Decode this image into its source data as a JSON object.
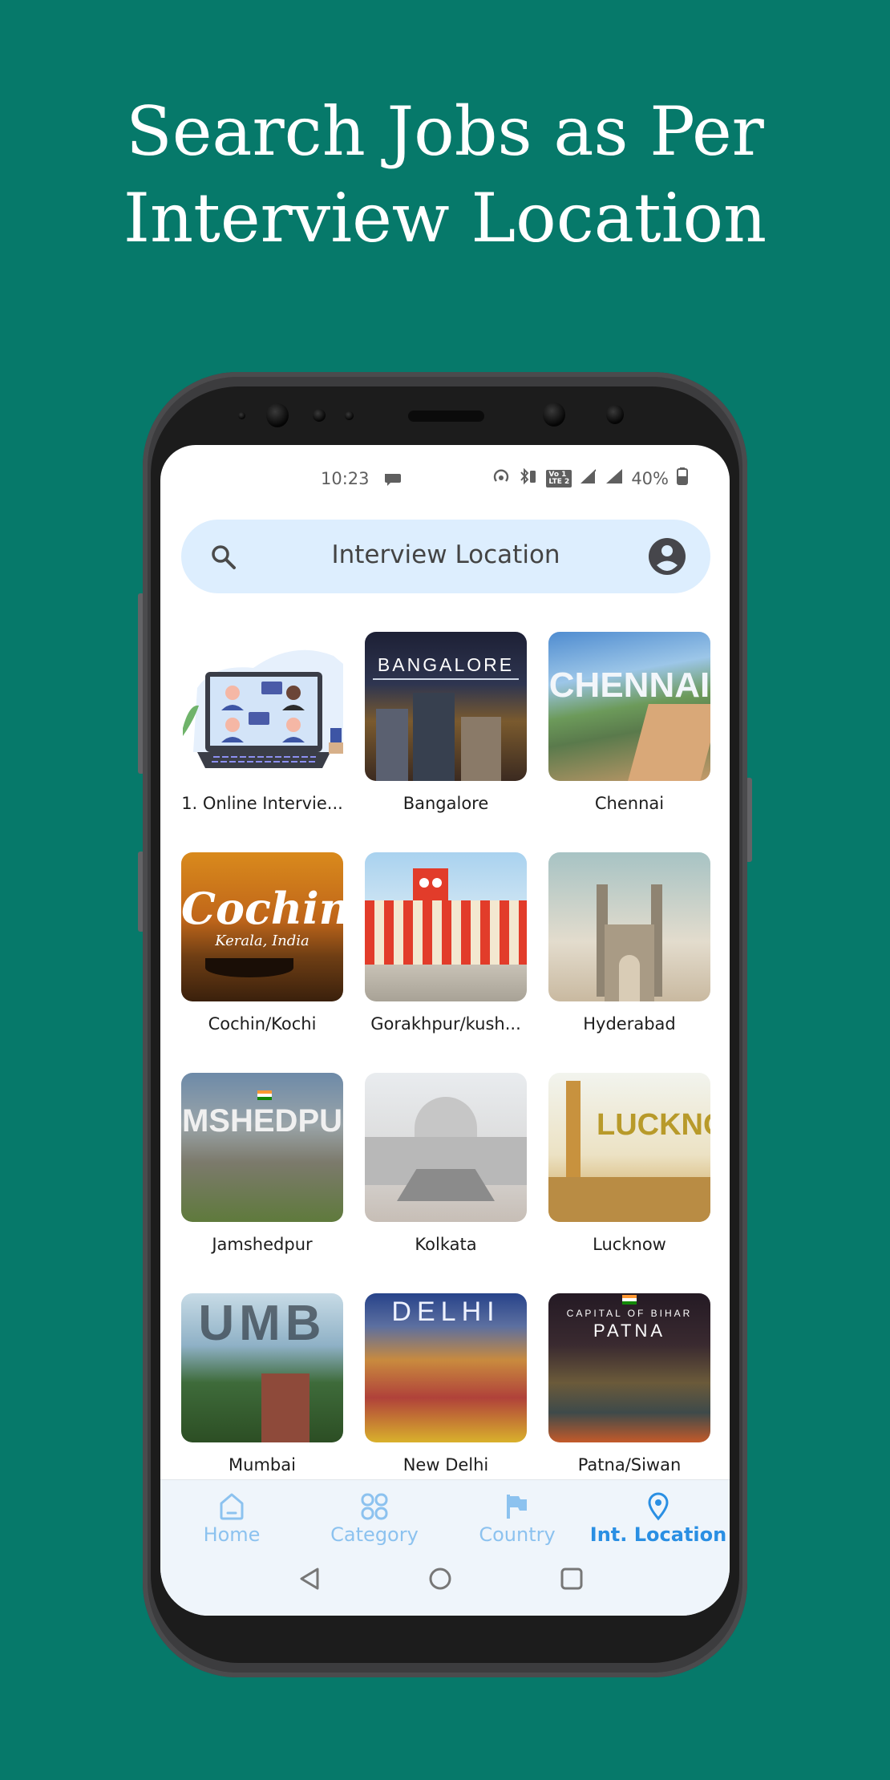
{
  "promo": {
    "title_line1": "Search Jobs as Per",
    "title_line2": "Interview Location",
    "background_color": "#06796a"
  },
  "status_bar": {
    "time": "10:23",
    "battery": "40%",
    "network_badge_top": "Vo 1",
    "network_badge_bottom": "LTE 2",
    "icons": [
      "message-icon",
      "hotspot-icon",
      "bluetooth-icon",
      "volte-icon",
      "signal-1-icon",
      "signal-2-icon",
      "battery-icon"
    ]
  },
  "search_bar": {
    "title": "Interview Location",
    "icon_left": "search-icon",
    "icon_right": "account-icon"
  },
  "locations": [
    {
      "label": "1. Online Intervie...",
      "image": "online-interview-illustration"
    },
    {
      "label": "Bangalore",
      "image": "bangalore-photo",
      "overlay": "BANGALORE"
    },
    {
      "label": "Chennai",
      "image": "chennai-photo",
      "overlay": "CHENNAI"
    },
    {
      "label": "Cochin/Kochi",
      "image": "cochin-photo",
      "overlay": "Cochin",
      "overlay_sub": "Kerala, India"
    },
    {
      "label": "Gorakhpur/kush...",
      "image": "gorakhpur-photo"
    },
    {
      "label": "Hyderabad",
      "image": "hyderabad-photo"
    },
    {
      "label": "Jamshedpur",
      "image": "jamshedpur-photo",
      "overlay": "MSHEDPU"
    },
    {
      "label": "Kolkata",
      "image": "kolkata-photo"
    },
    {
      "label": "Lucknow",
      "image": "lucknow-photo",
      "overlay": "LUCKNO"
    },
    {
      "label": "Mumbai",
      "image": "mumbai-photo",
      "overlay": "UMB"
    },
    {
      "label": "New Delhi",
      "image": "delhi-photo",
      "overlay": "DELHI"
    },
    {
      "label": "Patna/Siwan",
      "image": "patna-photo",
      "overlay": "PATNA",
      "overlay_sub": "CAPITAL OF BIHAR"
    }
  ],
  "bottom_nav": {
    "items": [
      {
        "label": "Home",
        "icon": "home-icon",
        "active": false
      },
      {
        "label": "Category",
        "icon": "category-icon",
        "active": false
      },
      {
        "label": "Country",
        "icon": "flag-icon",
        "active": false
      },
      {
        "label": "Int. Location",
        "icon": "location-pin-icon",
        "active": true
      }
    ],
    "active_color": "#2a8fe3",
    "inactive_color": "#8cc2ef"
  },
  "system_nav": [
    "back-icon",
    "home-circle-icon",
    "recents-icon"
  ]
}
